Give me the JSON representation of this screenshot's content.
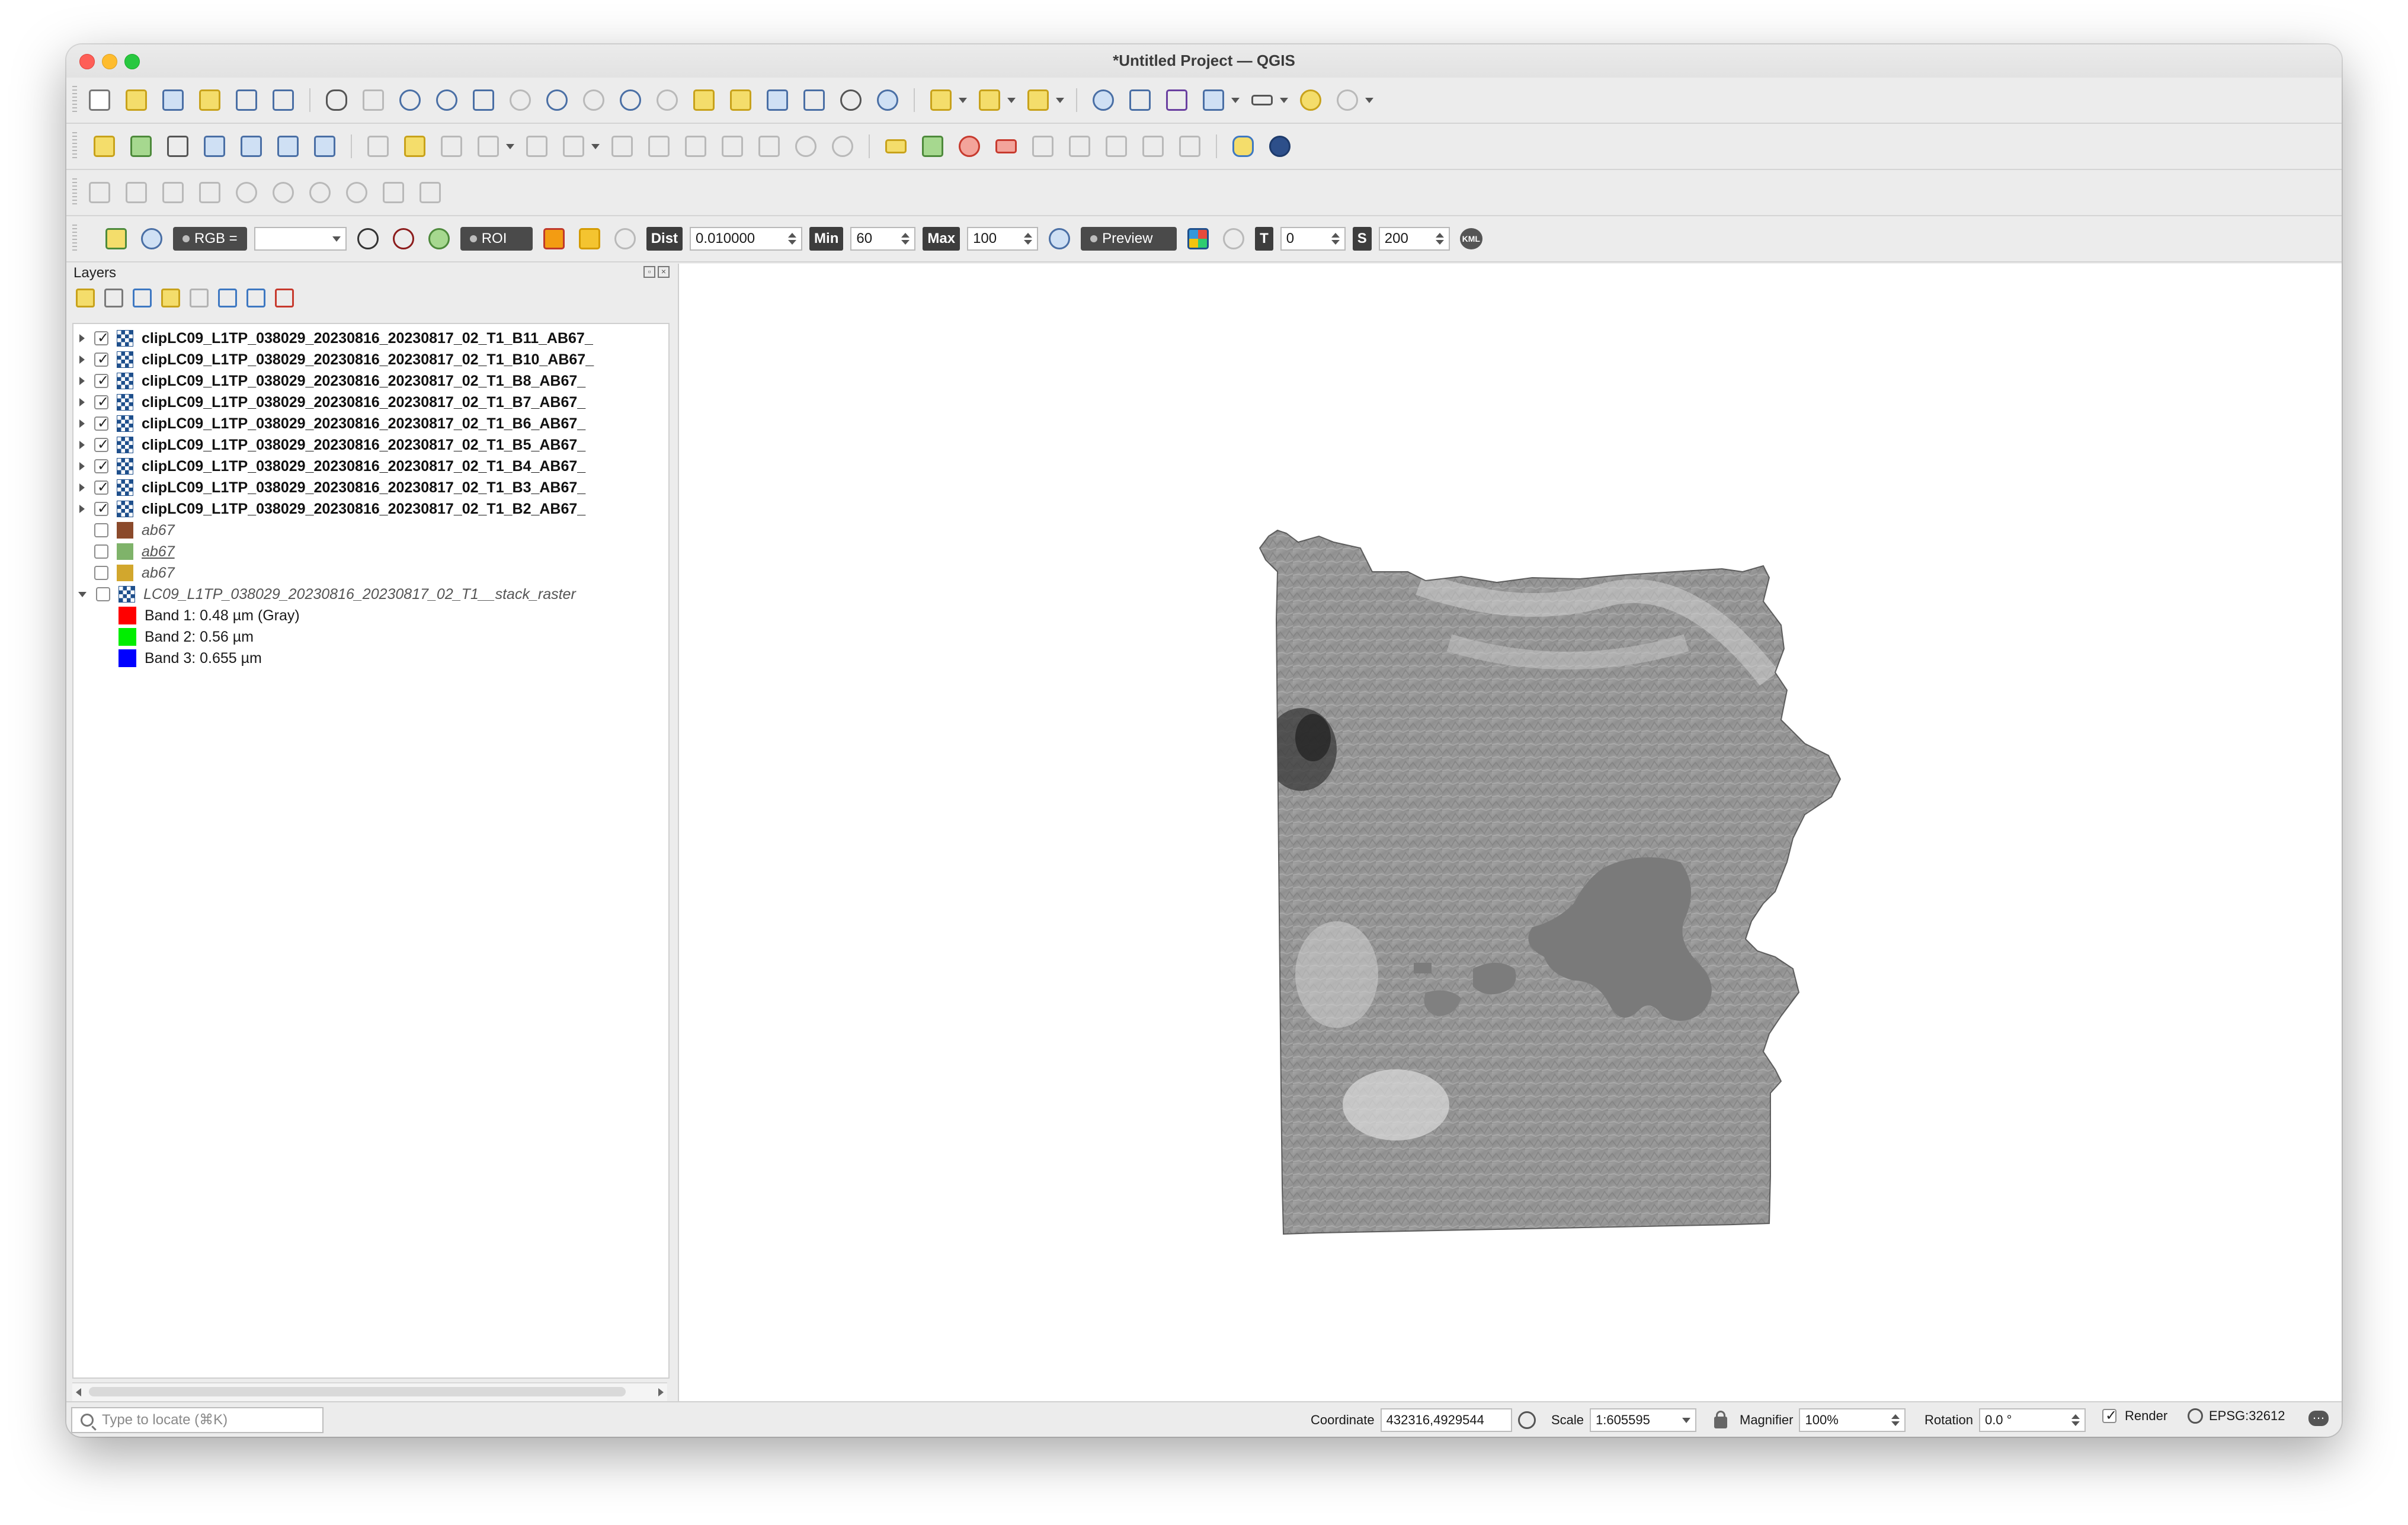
{
  "window": {
    "title": "*Untitled Project — QGIS"
  },
  "toolbar4": {
    "rgb_label": "RGB =",
    "rgb_value": "",
    "roi_label": "ROI",
    "dist_label": "Dist",
    "dist_value": "0.010000",
    "min_label": "Min",
    "min_value": "60",
    "max_label": "Max",
    "max_value": "100",
    "preview_label": "Preview",
    "t_label": "T",
    "t_value": "0",
    "s_label": "S",
    "s_value": "200",
    "kml_label": "KML"
  },
  "layers_panel": {
    "title": "Layers",
    "layers": [
      {
        "name": "clipLC09_L1TP_038029_20230816_20230817_02_T1_B11_AB67_",
        "checked": true
      },
      {
        "name": "clipLC09_L1TP_038029_20230816_20230817_02_T1_B10_AB67_",
        "checked": true
      },
      {
        "name": "clipLC09_L1TP_038029_20230816_20230817_02_T1_B8_AB67_",
        "checked": true
      },
      {
        "name": "clipLC09_L1TP_038029_20230816_20230817_02_T1_B7_AB67_",
        "checked": true
      },
      {
        "name": "clipLC09_L1TP_038029_20230816_20230817_02_T1_B6_AB67_",
        "checked": true
      },
      {
        "name": "clipLC09_L1TP_038029_20230816_20230817_02_T1_B5_AB67_",
        "checked": true
      },
      {
        "name": "clipLC09_L1TP_038029_20230816_20230817_02_T1_B4_AB67_",
        "checked": true
      },
      {
        "name": "clipLC09_L1TP_038029_20230816_20230817_02_T1_B3_AB67_",
        "checked": true
      },
      {
        "name": "clipLC09_L1TP_038029_20230816_20230817_02_T1_B2_AB67_",
        "checked": true
      }
    ],
    "vector_layers": [
      {
        "name": "ab67",
        "color": "#8b4a2b"
      },
      {
        "name": "ab67",
        "color": "#7fb36a"
      },
      {
        "name": "ab67",
        "color": "#d2a72d"
      }
    ],
    "stack_layer": {
      "name": "LC09_L1TP_038029_20230816_20230817_02_T1__stack_raster",
      "bands": [
        {
          "label": "Band 1: 0.48  µm (Gray)",
          "color": "#ff0000"
        },
        {
          "label": "Band 2: 0.56  µm",
          "color": "#00ee00"
        },
        {
          "label": "Band 3: 0.655 µm",
          "color": "#0000ff"
        }
      ]
    }
  },
  "statusbar": {
    "locator_placeholder": "Type to locate (⌘K)",
    "coordinate_label": "Coordinate",
    "coordinate_value": "432316,4929544",
    "scale_label": "Scale",
    "scale_value": "1:605595",
    "magnifier_label": "Magnifier",
    "magnifier_value": "100%",
    "rotation_label": "Rotation",
    "rotation_value": "0.0 °",
    "render_label": "Render",
    "crs_label": "EPSG:32612"
  }
}
